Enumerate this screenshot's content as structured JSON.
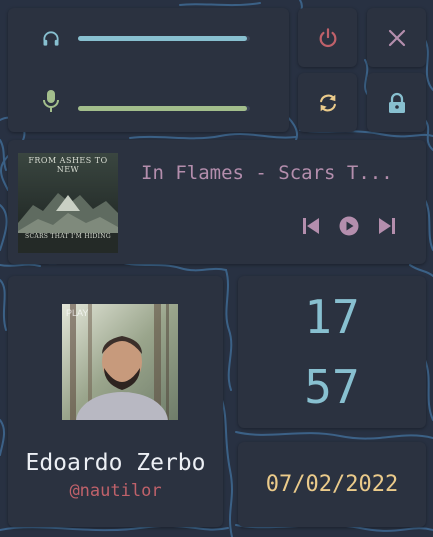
{
  "colors": {
    "background": "#283142",
    "panel": "#2b3240",
    "volume_accent": "#88c0d0",
    "mic_accent": "#a3be8c",
    "power_accent": "#bf616a",
    "close_accent": "#b48ead",
    "refresh_accent": "#ebcb8b",
    "lock_accent": "#88c0d0",
    "song_title": "#b48ead",
    "clock": "#88c0d0",
    "date": "#ebcb8b",
    "username": "#bf616a",
    "name": "#eceff4"
  },
  "controls": {
    "volume": {
      "icon": "headphones-icon",
      "level": 0.98
    },
    "microphone": {
      "icon": "microphone-icon",
      "level": 0.98
    }
  },
  "buttons": {
    "power": {
      "icon": "power-icon"
    },
    "close": {
      "icon": "close-icon"
    },
    "refresh": {
      "icon": "refresh-icon"
    },
    "lock": {
      "icon": "lock-icon"
    }
  },
  "music": {
    "title": "In Flames - Scars T...",
    "album_art": {
      "band": "FROM ASHES TO NEW",
      "album": "SCARS THAT I'M HIDING"
    },
    "controls": {
      "previous": "skip-previous-icon",
      "play": "play-circle-icon",
      "next": "skip-next-icon"
    }
  },
  "profile": {
    "name": "Edoardo Zerbo",
    "username": "@nautilor"
  },
  "clock": {
    "hours": "17",
    "minutes": "57"
  },
  "date": "07/02/2022"
}
